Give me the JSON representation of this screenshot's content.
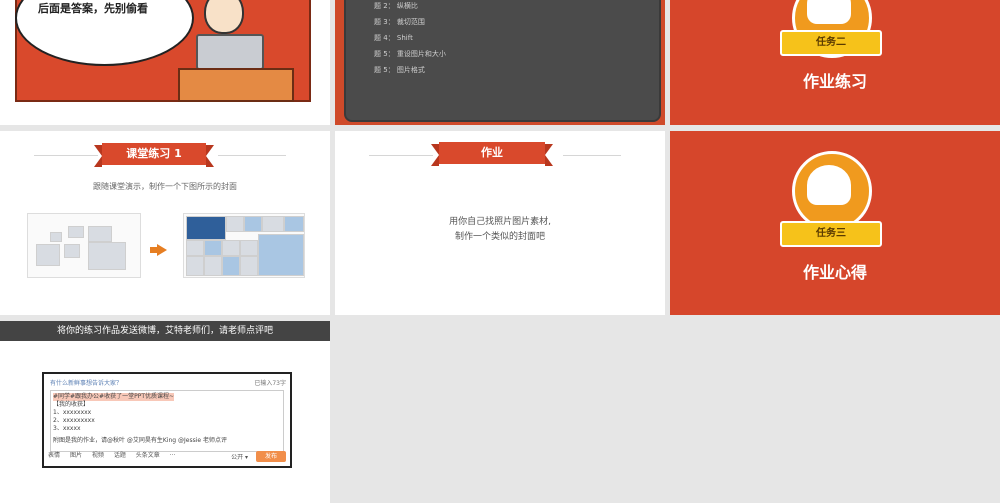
{
  "slide1": {
    "bubble_text": "后面是答案，先别偷看"
  },
  "slide2": {
    "task_items": [
      "题 2： 纵横比",
      "题 3： 裁切范围",
      "题 4： Shift",
      "题 5： 重设图片和大小",
      "题 5： 图片格式"
    ]
  },
  "slide3": {
    "badge": "任务二",
    "heading": "作业练习"
  },
  "slide4": {
    "title": "课堂练习 1",
    "subtitle": "跟随课堂演示，制作一个下图所示的封面"
  },
  "slide5": {
    "title": "作业",
    "body_line1": "用你自己找照片图片素材,",
    "body_line2": "制作一个类似的封面吧"
  },
  "slide6": {
    "badge": "任务三",
    "heading": "作业心得"
  },
  "slide7": {
    "banner": "将你的练习作品发送微博，艾特老师们，请老师点评吧",
    "weibo_header": "有什么新鲜事想告诉大家？",
    "weibo_count": "已输入73字",
    "lines": [
      "#同学#跟我办公#收获了一堂PPT优质课程~",
      "【我的收获】",
      "1、xxxxxxxx",
      "2、xxxxxxxxx",
      "3、xxxxx",
      "附图是我的作业，请@秋叶 @艾同昊有生King @Jessie 老师点评"
    ],
    "toolbar": [
      "表情",
      "图片",
      "视频",
      "话题",
      "头条文章",
      "···"
    ],
    "visibility": "公开 ▾",
    "send": "发布"
  },
  "colors": {
    "brand_red": "#d6462b",
    "ribbon_yellow": "#f6c21a",
    "badge_orange": "#f09a1e"
  }
}
